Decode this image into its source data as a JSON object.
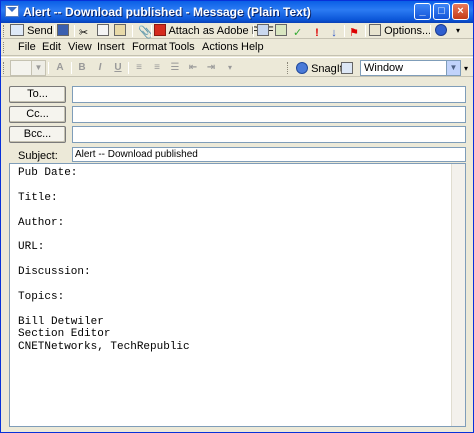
{
  "window": {
    "title": "Alert -- Download published - Message (Plain Text)"
  },
  "toolbar1": {
    "send": "Send",
    "attach_pdf": "Attach as Adobe PDF",
    "options": "Options..."
  },
  "menu": {
    "items": [
      "File",
      "Edit",
      "View",
      "Insert",
      "Format",
      "Tools",
      "Actions",
      "Help"
    ]
  },
  "toolbar3": {
    "bold": "B",
    "italic": "I",
    "underline": "U",
    "snagit": "SnagIt",
    "window_combo": "Window"
  },
  "address": {
    "to_label": "To...",
    "cc_label": "Cc...",
    "bcc_label": "Bcc...",
    "to_value": "",
    "cc_value": "",
    "bcc_value": "",
    "subject_label": "Subject:",
    "subject_value": "Alert -- Download published"
  },
  "body": {
    "text": "Pub Date:\n\nTitle:\n\nAuthor:\n\nURL:\n\nDiscussion:\n\nTopics:\n\nBill Detwiler\nSection Editor\nCNETNetworks, TechRepublic"
  }
}
